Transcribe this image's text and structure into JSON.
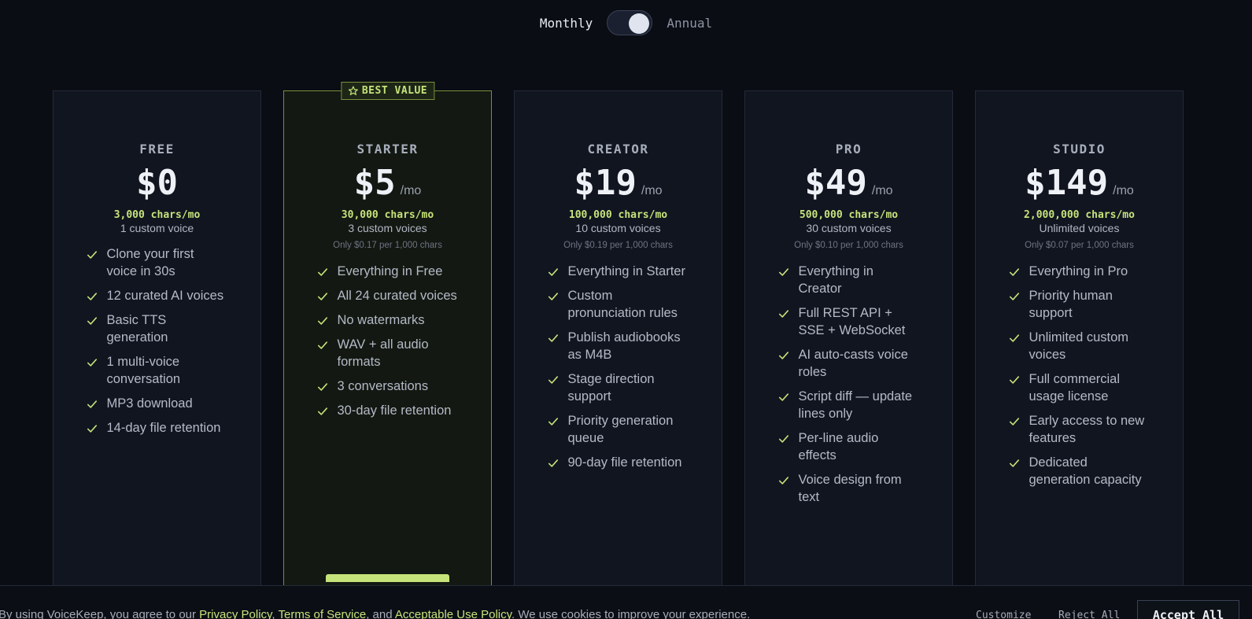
{
  "billing": {
    "monthly_label": "Monthly",
    "annual_label": "Annual"
  },
  "accent_color": "#c6e37a",
  "plans": [
    {
      "name": "FREE",
      "price": "$0",
      "per": "",
      "chars": "3,000 chars/mo",
      "voices": "1 custom voice",
      "rate": "",
      "features": [
        "Clone your first voice in 30s",
        "12 curated AI voices",
        "Basic TTS generation",
        "1 multi-voice conversation",
        "MP3 download",
        "14-day file retention"
      ]
    },
    {
      "name": "STARTER",
      "badge": "BEST VALUE",
      "price": "$5",
      "per": "/mo",
      "chars": "30,000 chars/mo",
      "voices": "3 custom voices",
      "rate": "Only $0.17 per 1,000 chars",
      "features": [
        "Everything in Free",
        "All 24 curated voices",
        "No watermarks",
        "WAV + all audio formats",
        "3 conversations",
        "30-day file retention"
      ]
    },
    {
      "name": "CREATOR",
      "price": "$19",
      "per": "/mo",
      "chars": "100,000 chars/mo",
      "voices": "10 custom voices",
      "rate": "Only $0.19 per 1,000 chars",
      "features": [
        "Everything in Starter",
        "Custom pronunciation rules",
        "Publish audiobooks as M4B",
        "Stage direction support",
        "Priority generation queue",
        "90-day file retention"
      ]
    },
    {
      "name": "PRO",
      "price": "$49",
      "per": "/mo",
      "chars": "500,000 chars/mo",
      "voices": "30 custom voices",
      "rate": "Only $0.10 per 1,000 chars",
      "features": [
        "Everything in Creator",
        "Full REST API + SSE + WebSocket",
        "AI auto-casts voice roles",
        "Script diff — update lines only",
        "Per-line audio effects",
        "Voice design from text"
      ]
    },
    {
      "name": "STUDIO",
      "price": "$149",
      "per": "/mo",
      "chars": "2,000,000 chars/mo",
      "voices": "Unlimited voices",
      "rate": "Only $0.07 per 1,000 chars",
      "features": [
        "Everything in Pro",
        "Priority human support",
        "Unlimited custom voices",
        "Full commercial usage license",
        "Early access to new features",
        "Dedicated generation capacity"
      ]
    }
  ],
  "cookie": {
    "text_1": "By using VoiceKeep, you agree to our ",
    "privacy": "Privacy Policy",
    "sep_1": ", ",
    "terms": "Terms of Service",
    "sep_2": ", and ",
    "aup": "Acceptable Use Policy",
    "text_2": ". We use cookies to improve your experience.",
    "customize": "Customize",
    "reject": "Reject All",
    "accept": "Accept All"
  }
}
